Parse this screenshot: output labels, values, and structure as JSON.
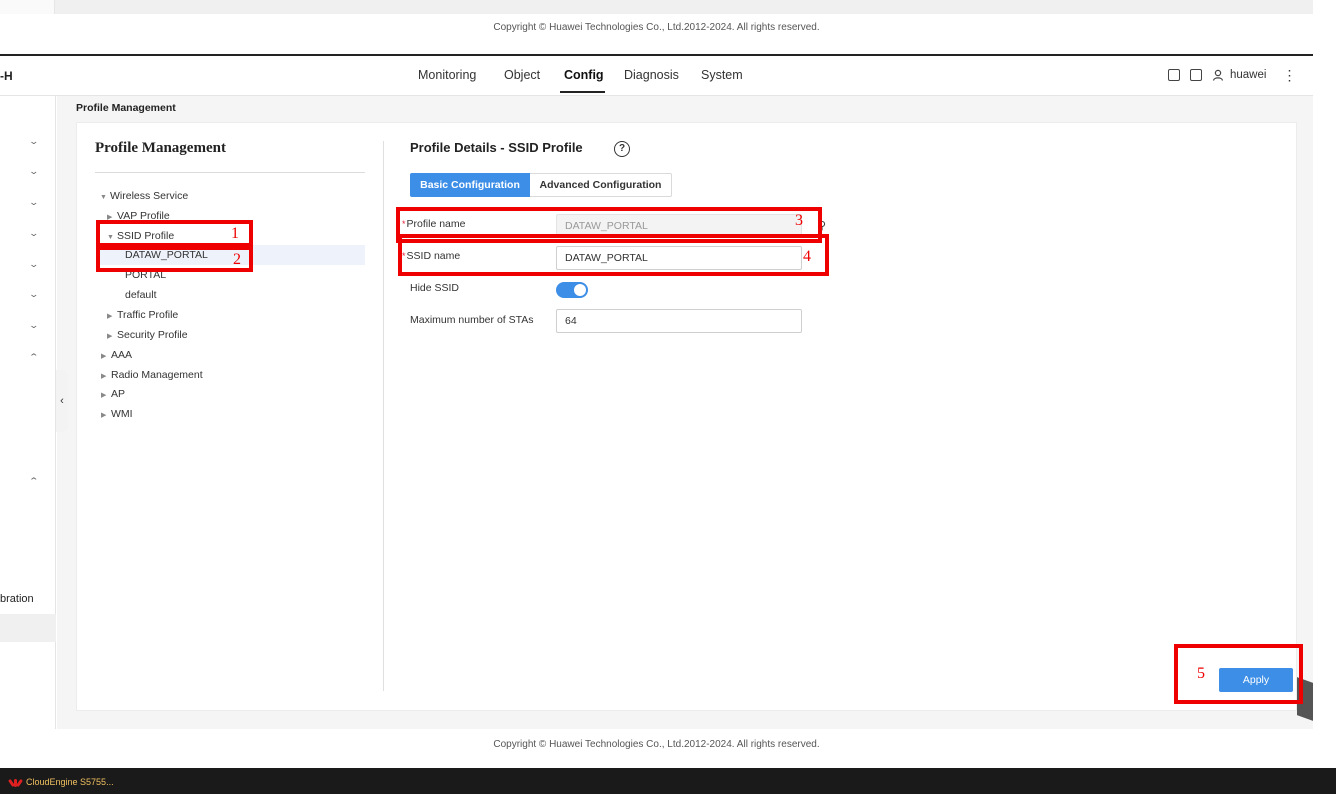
{
  "copyright": "Copyright © Huawei Technologies Co., Ltd.2012-2024. All rights reserved.",
  "brand": "-H",
  "nav": {
    "monitoring": "Monitoring",
    "object": "Object",
    "config": "Config",
    "diagnosis": "Diagnosis",
    "system": "System"
  },
  "user": {
    "name": "huawei"
  },
  "sidenav": {
    "partial_label": "bration"
  },
  "breadcrumb": "Profile Management",
  "tree": {
    "title": "Profile Management",
    "wireless_service": "Wireless Service",
    "vap_profile": "VAP Profile",
    "ssid_profile": "SSID Profile",
    "dataw_portal": "DATAW_PORTAL",
    "portal": "PORTAL",
    "default": "default",
    "traffic_profile": "Traffic Profile",
    "security_profile": "Security Profile",
    "aaa": "AAA",
    "radio_management": "Radio Management",
    "ap": "AP",
    "wmi": "WMI"
  },
  "details": {
    "title": "Profile Details - SSID Profile",
    "tab_basic": "Basic Configuration",
    "tab_advanced": "Advanced Configuration",
    "profile_name_label": "Profile name",
    "profile_name_value": "DATAW_PORTAL",
    "ssid_name_label": "SSID name",
    "ssid_name_value": "DATAW_PORTAL",
    "hide_ssid_label": "Hide SSID",
    "hide_ssid_on": true,
    "max_sta_label": "Maximum number of STAs",
    "max_sta_value": "64",
    "apply_label": "Apply"
  },
  "taskbar": {
    "app_label": "CloudEngine S5755..."
  },
  "annotations": [
    "1",
    "2",
    "3",
    "4",
    "5"
  ],
  "colors": {
    "accent": "#3c8ee6",
    "annotation": "#e00000"
  }
}
